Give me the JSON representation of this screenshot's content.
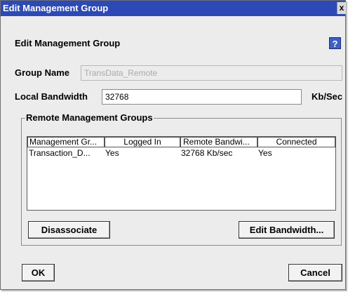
{
  "window": {
    "title": "Edit Management Group",
    "close_glyph": "x"
  },
  "header": {
    "title": "Edit Management Group",
    "help_glyph": "?"
  },
  "form": {
    "group_name_label": "Group Name",
    "group_name_value": "TransData_Remote",
    "local_bandwidth_label": "Local Bandwidth",
    "local_bandwidth_value": "32768",
    "bandwidth_unit": "Kb/Sec"
  },
  "remote_groups": {
    "title": "Remote Management Groups",
    "columns": [
      "Management Gr...",
      "Logged In",
      "Remote Bandwi...",
      "Connected"
    ],
    "rows": [
      [
        "Transaction_D...",
        "Yes",
        "32768 Kb/sec",
        "Yes"
      ]
    ],
    "disassociate_label": "Disassociate",
    "edit_bandwidth_label": "Edit Bandwidth..."
  },
  "footer": {
    "ok_label": "OK",
    "cancel_label": "Cancel"
  },
  "colors": {
    "titlebar": "#2d49b5",
    "dialog_bg": "#ececec",
    "help_icon": "#3d5fc4"
  },
  "icons": {
    "close": "close-icon",
    "help": "help-icon"
  }
}
